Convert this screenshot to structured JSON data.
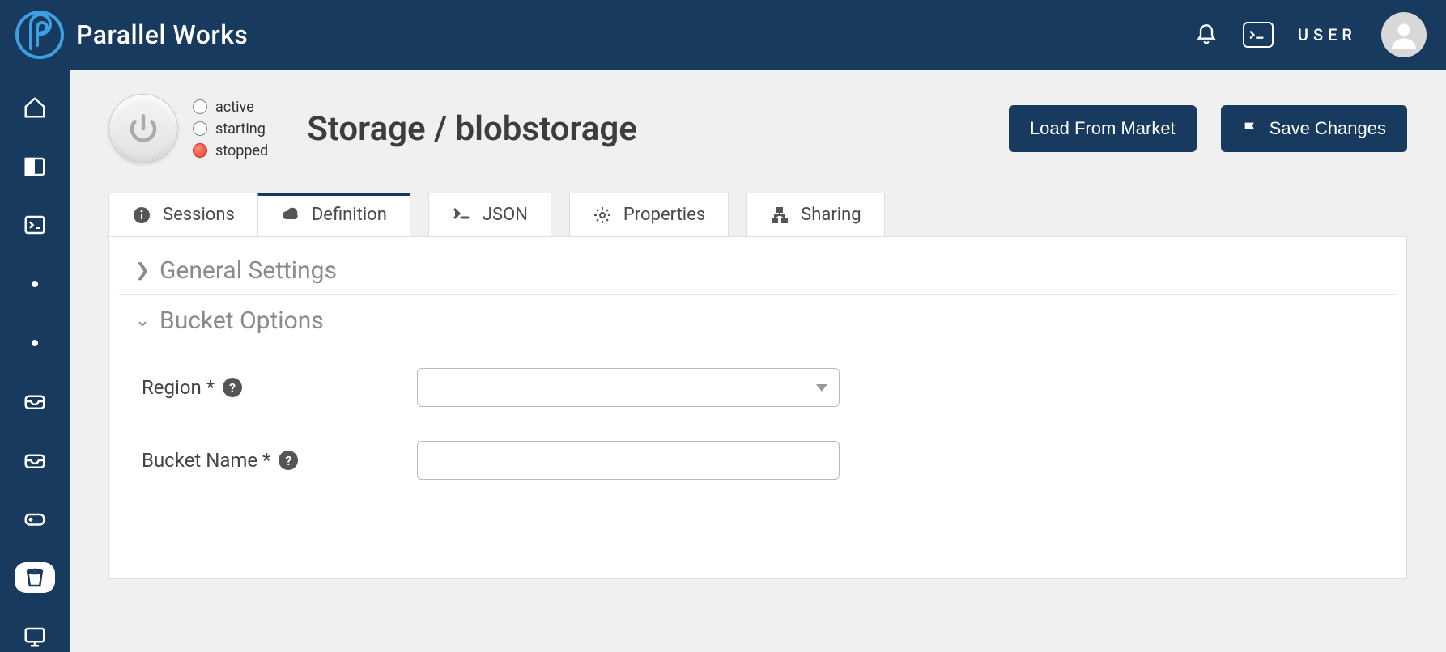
{
  "brand": "Parallel Works",
  "user_label": "USER",
  "status": {
    "active": "active",
    "starting": "starting",
    "stopped": "stopped",
    "current": "stopped"
  },
  "page_title": "Storage / blobstorage",
  "buttons": {
    "load_market": "Load From Market",
    "save_changes": "Save Changes"
  },
  "tabs": [
    {
      "id": "sessions",
      "label": "Sessions"
    },
    {
      "id": "definition",
      "label": "Definition"
    },
    {
      "id": "json",
      "label": "JSON"
    },
    {
      "id": "properties",
      "label": "Properties"
    },
    {
      "id": "sharing",
      "label": "Sharing"
    }
  ],
  "active_tab": "definition",
  "sections": {
    "general": "General Settings",
    "bucket": "Bucket Options"
  },
  "fields": {
    "region": {
      "label": "Region *",
      "value": ""
    },
    "bucket_name": {
      "label": "Bucket Name *",
      "value": ""
    }
  }
}
